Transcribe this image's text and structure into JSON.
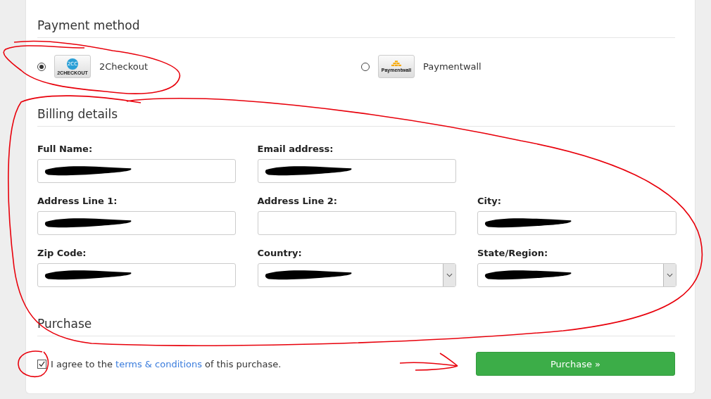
{
  "sections": [
    {
      "kind": "payment",
      "title": "Payment method",
      "methods": [
        {
          "label": "2Checkout",
          "selected": true,
          "kind": "twocheckout",
          "logo_mark": "2CC",
          "logo_text": "2CHECKOUT"
        },
        {
          "label": "Paymentwall",
          "selected": false,
          "kind": "paymentwall",
          "logo_text": "Paymentwall"
        }
      ]
    },
    {
      "kind": "billing",
      "title": "Billing details",
      "fields": [
        {
          "label": "Full Name:",
          "kind": "text",
          "redacted": true
        },
        {
          "label": "Email address:",
          "kind": "text",
          "redacted": true
        },
        {
          "kind": "empty"
        },
        {
          "label": "Address Line 1:",
          "kind": "text",
          "redacted": true
        },
        {
          "label": "Address Line 2:",
          "kind": "text",
          "redacted": false
        },
        {
          "label": "City:",
          "kind": "text",
          "redacted": true
        },
        {
          "label": "Zip Code:",
          "kind": "text",
          "redacted": true
        },
        {
          "label": "Country:",
          "kind": "select",
          "redacted": true
        },
        {
          "label": "State/Region:",
          "kind": "select",
          "redacted": true
        }
      ]
    },
    {
      "kind": "purchase",
      "title": "Purchase",
      "agree": {
        "checked": true,
        "before": "I agree to the ",
        "link": "terms & conditions",
        "after": " of this purchase."
      },
      "button": "Purchase »"
    }
  ],
  "annotations": [
    {
      "kind": "payment-loop"
    },
    {
      "kind": "billing-loop"
    },
    {
      "kind": "checkbox-loop"
    },
    {
      "kind": "arrow"
    }
  ]
}
